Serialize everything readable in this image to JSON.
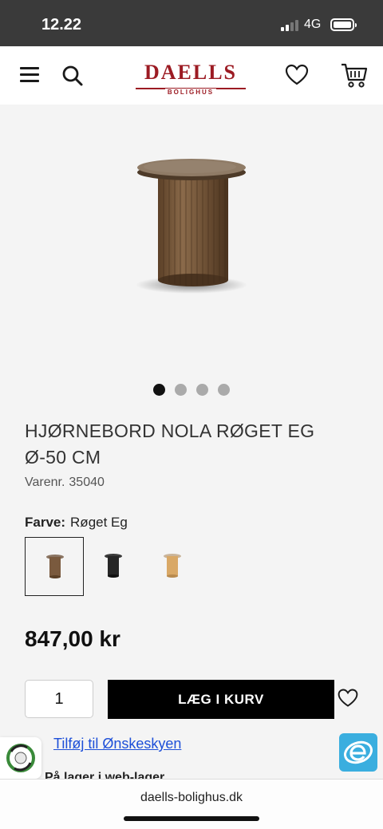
{
  "status_bar": {
    "time": "12.22",
    "network": "4G"
  },
  "header": {
    "logo_main": "DAELLS",
    "logo_sub": "BOLIGHUS",
    "brand_color": "#9c1b23",
    "icons": [
      "menu-icon",
      "search-icon",
      "heart-icon",
      "cart-icon"
    ]
  },
  "gallery": {
    "image_count": 4,
    "active_index": 1
  },
  "product": {
    "title": "HJØRNEBORD NOLA RØGET EG Ø-50 CM",
    "sku_label": "Varenr.",
    "sku": "35040",
    "color_label": "Farve:",
    "color_value": "Røget Eg",
    "swatches": [
      {
        "color": "#7a5a3e",
        "selected": true
      },
      {
        "color": "#262626",
        "selected": false
      },
      {
        "color": "#d9a866",
        "selected": false
      }
    ],
    "price": "847,00 kr"
  },
  "purchase": {
    "quantity": "1",
    "add_to_cart_label": "LÆG I KURV"
  },
  "wishlist_link": "Tilføj til Ønskeskyen",
  "peek_text": "På lager i web-lager",
  "browser": {
    "url": "daells-bolighus.dk"
  }
}
